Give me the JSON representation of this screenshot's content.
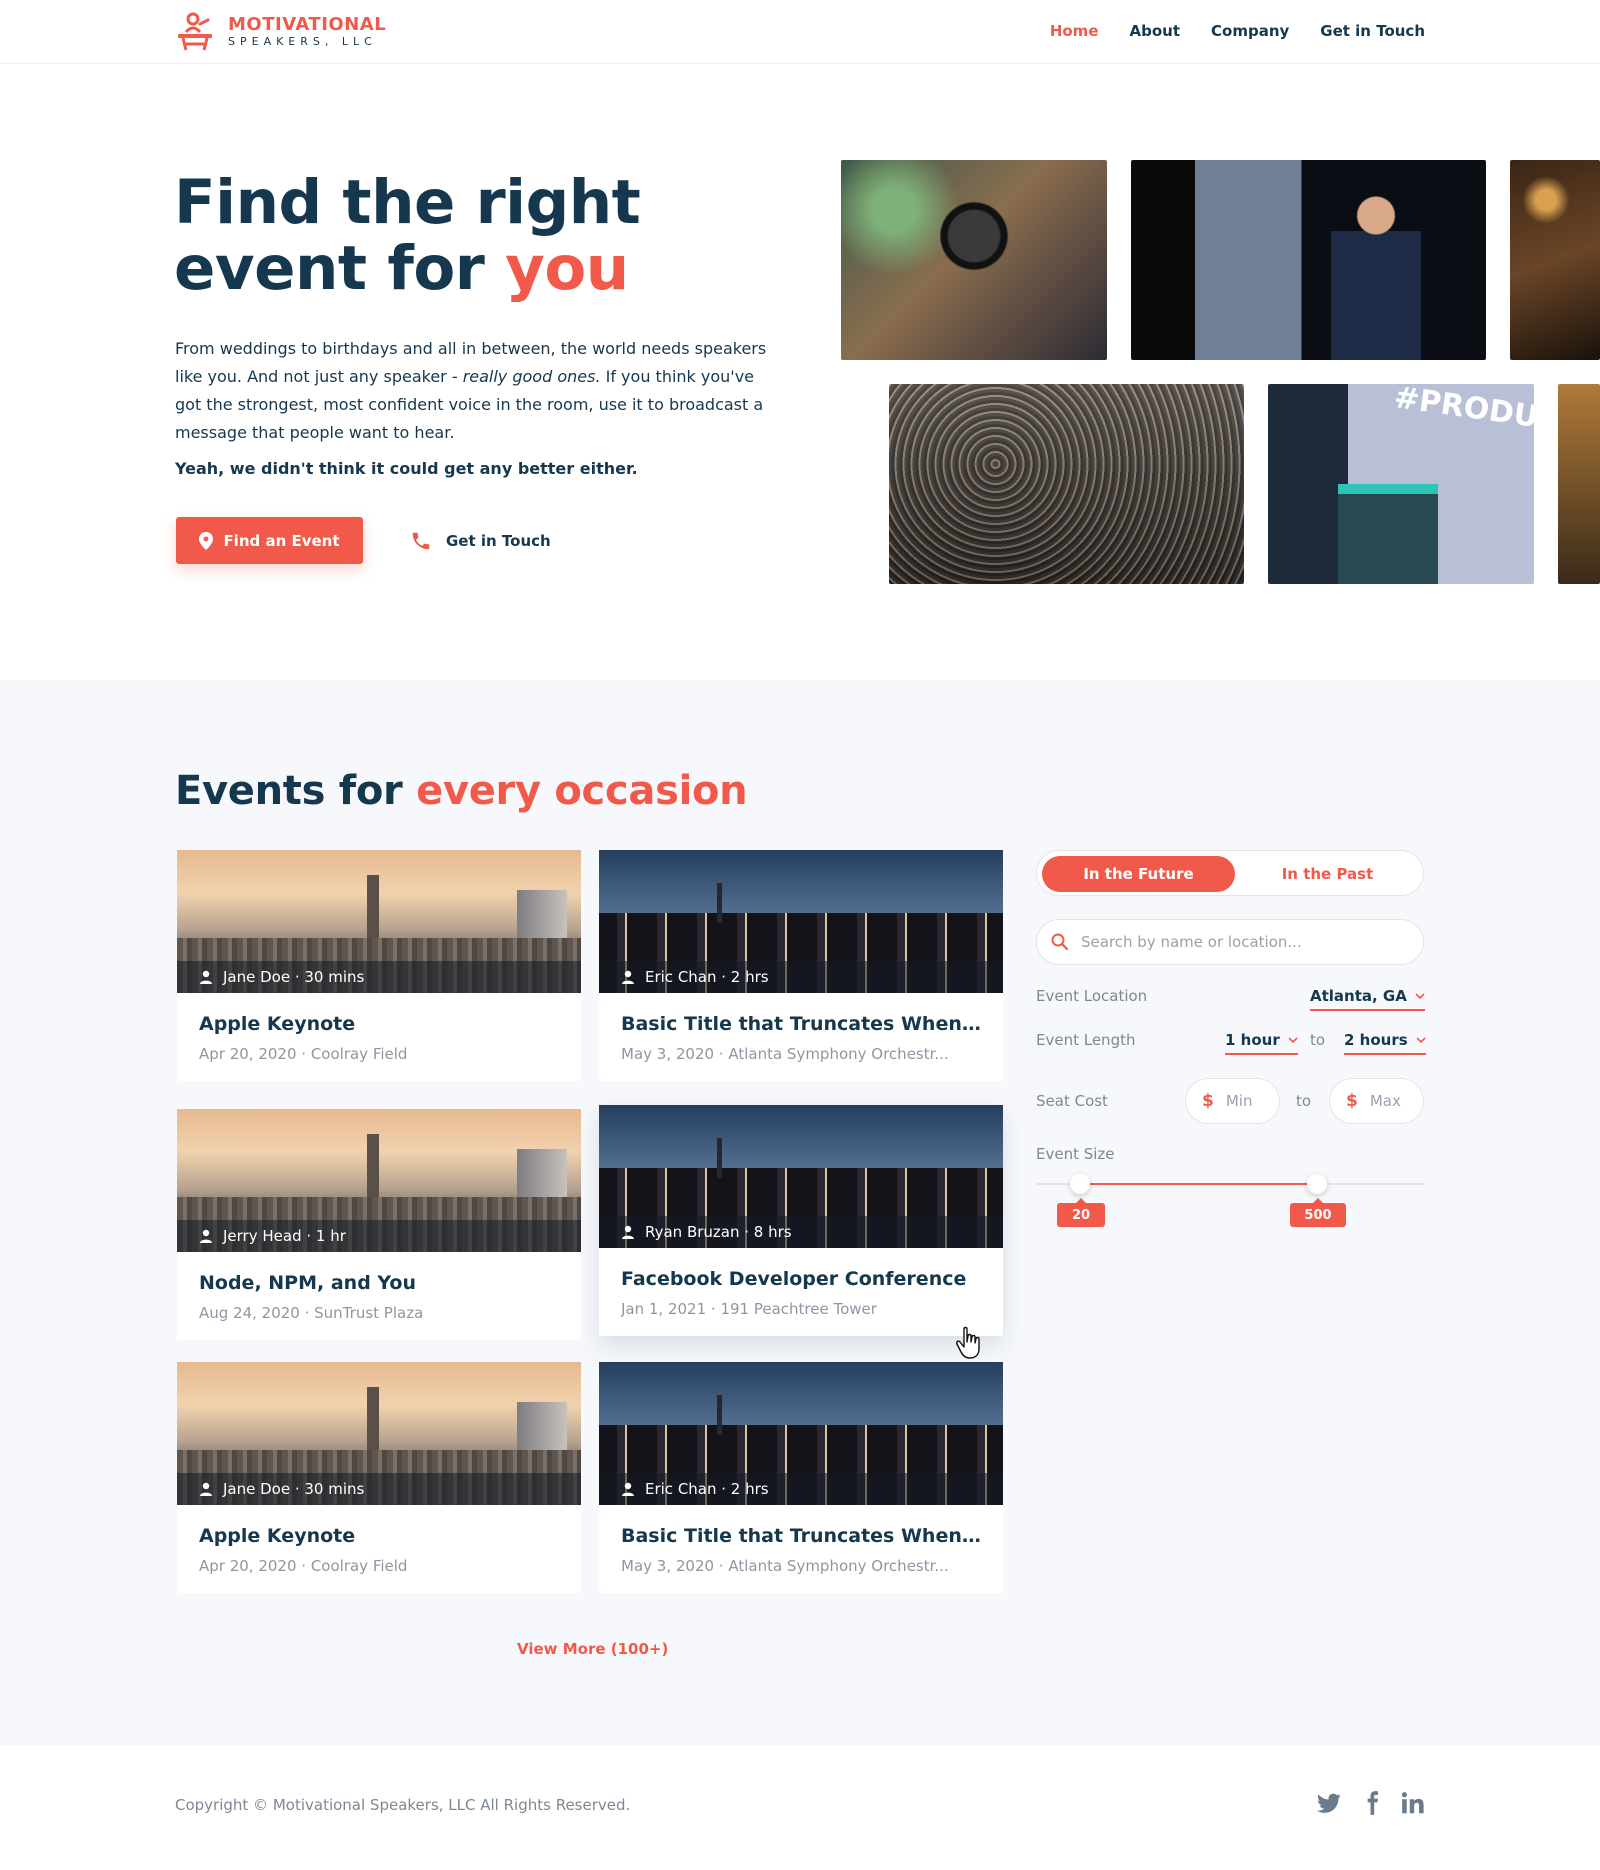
{
  "brand": {
    "line1": "MOTIVATIONAL",
    "line2": "SPEAKERS, LLC",
    "accent_color": "#f15a4a",
    "text_color": "#16384f"
  },
  "nav": {
    "items": [
      "Home",
      "About",
      "Company",
      "Get in Touch"
    ],
    "active": "Home"
  },
  "hero": {
    "title_part1": "Find the right",
    "title_part2": "event for ",
    "title_accent": "you",
    "body_part1": "From weddings to birthdays and all in between, the world needs speakers like you.  And not just any speaker - ",
    "body_italic": "really good ones.",
    "body_part2": "  If you think you've got the strongest, most confident voice in the room, use it to broadcast a message that people want to hear.",
    "strong_line": "Yeah, we didn't think it could get any better either.",
    "primary_button": "Find an Event",
    "secondary_button": "Get in Touch",
    "photo_text": "#PRODUCTCON"
  },
  "events": {
    "title_part1": "Events for ",
    "title_accent": "every occasion",
    "cards": [
      {
        "speaker": "Jane Doe · 30 mins",
        "title": "Apple Keynote",
        "meta": "Apr 20, 2020 · Coolray Field",
        "image": "city-day"
      },
      {
        "speaker": "Eric Chan · 2 hrs",
        "title": "Basic Title that Truncates When...",
        "meta": "May 3, 2020 · Atlanta Symphony Orchestr...",
        "image": "city-night"
      },
      {
        "speaker": "Jerry Head · 1 hr",
        "title": "Node, NPM, and You",
        "meta": "Aug 24, 2020 · SunTrust Plaza",
        "image": "city-day"
      },
      {
        "speaker": "Ryan Bruzan · 8 hrs",
        "title": "Facebook Developer Conference",
        "meta": "Jan 1, 2021 · 191 Peachtree Tower",
        "image": "city-night"
      },
      {
        "speaker": "Jane Doe · 30 mins",
        "title": "Apple Keynote",
        "meta": "Apr 20, 2020 · Coolray Field",
        "image": "city-day"
      },
      {
        "speaker": "Eric Chan · 2 hrs",
        "title": "Basic Title that Truncates When...",
        "meta": "May 3, 2020 · Atlanta Symphony Orchestr...",
        "image": "city-night"
      }
    ],
    "view_more": "View More (100+)"
  },
  "filters": {
    "toggle_active": "In the Future",
    "toggle_inactive": "In the Past",
    "search_placeholder": "Search by name or location...",
    "location_label": "Event Location",
    "location_value": "Atlanta, GA",
    "length_label": "Event Length",
    "length_min": "1 hour",
    "length_to": "to",
    "length_max": "2 hours",
    "cost_label": "Seat Cost",
    "cost_min_placeholder": "Min",
    "cost_to": "to",
    "cost_max_placeholder": "Max",
    "currency_symbol": "$",
    "size_label": "Event Size",
    "size_min": "20",
    "size_max": "500"
  },
  "footer": {
    "copyright": "Copyright © Motivational Speakers, LLC All Rights Reserved.",
    "social": [
      "twitter-icon",
      "facebook-icon",
      "linkedin-icon"
    ]
  }
}
